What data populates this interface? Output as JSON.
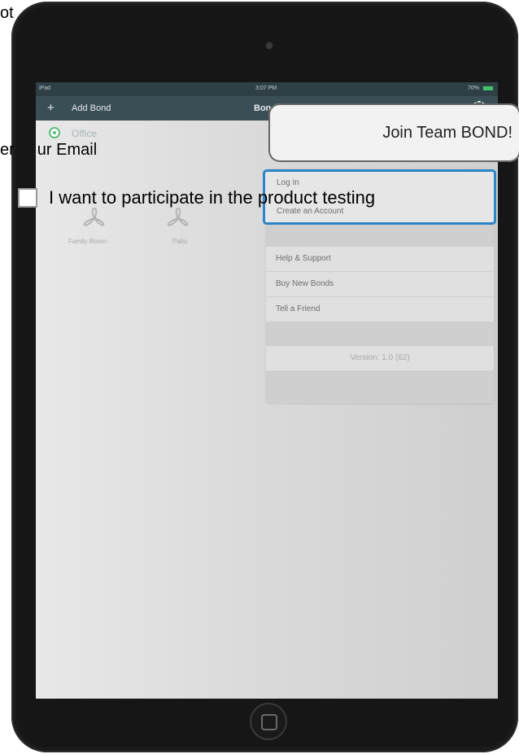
{
  "partial_text": {
    "top_left": "ot",
    "email_prefix": "er"
  },
  "overlays": {
    "join_button_label": "Join Team BOND!",
    "email_label_suffix": "ur Email",
    "checkbox_label": "I want to participate in the product testing"
  },
  "status_bar": {
    "left": "iPad",
    "time": "3:07 PM",
    "battery": "70%"
  },
  "nav": {
    "add_label": "Add Bond",
    "title": "Bonds"
  },
  "location": {
    "name": "Office"
  },
  "fans": [
    {
      "label": "Family Room"
    },
    {
      "label": "Patio"
    }
  ],
  "menu": {
    "login": "Log In",
    "create_account": "Create an Account",
    "items": [
      "Help & Support",
      "Buy New Bonds",
      "Tell a Friend"
    ],
    "version": "Version: 1.0 (62)"
  },
  "icons": {
    "add": "plus-icon",
    "refresh": "refresh-icon",
    "settings": "gear-icon",
    "fan": "fan-icon",
    "home": "home-button-icon"
  },
  "colors": {
    "nav_bg": "#3a4e55",
    "status_bg": "#2e4046",
    "accent_blue": "#2a86c6",
    "green": "#5bbf7a"
  }
}
